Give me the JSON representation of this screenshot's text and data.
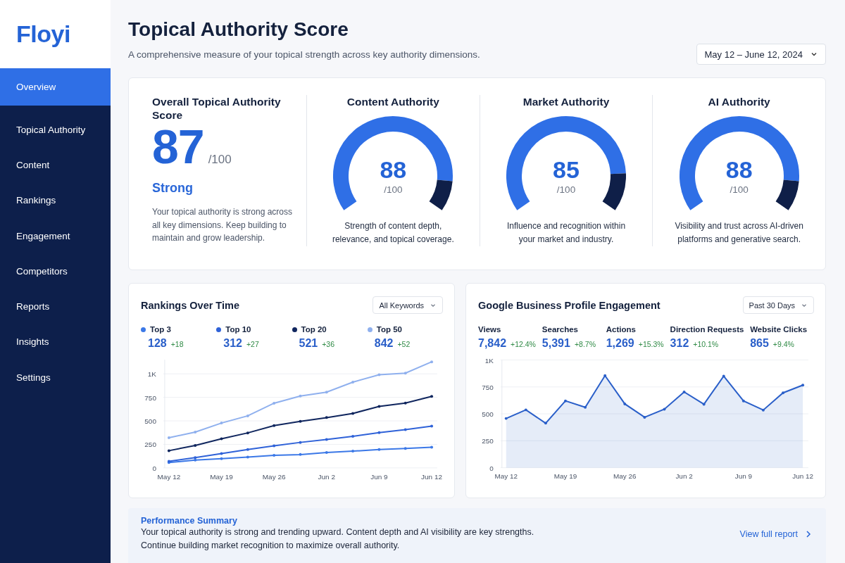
{
  "brand": "Floyi",
  "sidebar": {
    "items": [
      {
        "label": "Overview",
        "selected": true
      },
      {
        "label": "Topical Authority",
        "selected": false
      },
      {
        "label": "Content",
        "selected": false
      },
      {
        "label": "Rankings",
        "selected": false
      },
      {
        "label": "Engagement",
        "selected": false
      },
      {
        "label": "Competitors",
        "selected": false
      },
      {
        "label": "Reports",
        "selected": false
      },
      {
        "label": "Insights",
        "selected": false
      },
      {
        "label": "Settings",
        "selected": false
      }
    ]
  },
  "header": {
    "title": "Topical Authority Score",
    "subtitle": "A comprehensive measure of your topical strength across key authority dimensions.",
    "date_range": "May 12 – June 12, 2024"
  },
  "overall": {
    "title": "Overall Topical Authority Score",
    "score": "87",
    "max": "/100",
    "rating": "Strong",
    "description": "Your topical authority is strong across all key dimensions. Keep building to maintain and grow leadership."
  },
  "gauges": [
    {
      "title": "Content Authority",
      "score": "88",
      "max": "/100",
      "description": "Strength of content depth, relevance, and topical coverage."
    },
    {
      "title": "Market Authority",
      "score": "85",
      "max": "/100",
      "description": "Influence and recognition within your market and industry."
    },
    {
      "title": "AI Authority",
      "score": "88",
      "max": "/100",
      "description": "Visibility and trust across AI-driven platforms and generative search."
    }
  ],
  "rankings": {
    "title": "Rankings Over Time",
    "filter": "All Keywords",
    "stats": [
      {
        "value": "128",
        "change": "+18"
      },
      {
        "value": "312",
        "change": "+27"
      },
      {
        "value": "521",
        "change": "+36"
      },
      {
        "value": "842",
        "change": "+52"
      }
    ],
    "chart_data": {
      "type": "line",
      "categories": [
        "May 12",
        null,
        "May 19",
        null,
        "May 26",
        null,
        "Jun 2",
        null,
        "Jun 9",
        null,
        "Jun 12"
      ],
      "ylim": [
        0,
        1150
      ],
      "grid": true,
      "yticks": [
        0,
        250,
        500,
        750,
        {
          "value": 1000,
          "label": "1K"
        }
      ],
      "series": [
        {
          "name": "Top 3",
          "color": "#3b78e7",
          "values": [
            57,
            83,
            98,
            114,
            134,
            142,
            163,
            178,
            196,
            207,
            220
          ]
        },
        {
          "name": "Top 10",
          "color": "#2f62d8",
          "values": [
            70,
            109,
            152,
            196,
            235,
            271,
            302,
            336,
            375,
            406,
            444
          ]
        },
        {
          "name": "Top 20",
          "color": "#10265e",
          "values": [
            183,
            238,
            310,
            372,
            450,
            494,
            535,
            579,
            654,
            690,
            760
          ]
        },
        {
          "name": "Top 50",
          "color": "#8fb0ee",
          "values": [
            320,
            381,
            477,
            553,
            688,
            765,
            806,
            912,
            990,
            1008,
            1128
          ]
        }
      ]
    }
  },
  "engagement": {
    "title": "Google Business Profile Engagement",
    "filter": "Past 30 Days",
    "stats": [
      {
        "label": "Views",
        "value": "7,842",
        "change": "+12.4%"
      },
      {
        "label": "Searches",
        "value": "5,391",
        "change": "+8.7%"
      },
      {
        "label": "Actions",
        "value": "1,269",
        "change": "+15.3%"
      },
      {
        "label": "Direction Requests",
        "value": "312",
        "change": "+10.1%"
      },
      {
        "label": "Website Clicks",
        "value": "865",
        "change": "+9.4%"
      }
    ],
    "chart_data": {
      "type": "area",
      "categories": [
        "May 12",
        null,
        null,
        "May 19",
        null,
        null,
        "May 26",
        null,
        null,
        "Jun 2",
        null,
        null,
        "Jun 9",
        null,
        null,
        "Jun 12"
      ],
      "ylim": [
        0,
        1000
      ],
      "grid": true,
      "yticks": [
        0,
        250,
        500,
        750,
        {
          "value": 1000,
          "label": "1K"
        }
      ],
      "series": [
        {
          "color": "#2a5fc9",
          "values": [
            457,
            537,
            413,
            620,
            561,
            855,
            592,
            468,
            543,
            703,
            589,
            850,
            620,
            535,
            695,
            767
          ]
        }
      ]
    }
  },
  "summary": {
    "title": "Performance Summary",
    "lines": [
      "Your topical authority is strong and trending upward. Content depth and AI visibility are key strengths.",
      "Continue building market recognition to maximize overall authority."
    ],
    "link": "View full report"
  }
}
